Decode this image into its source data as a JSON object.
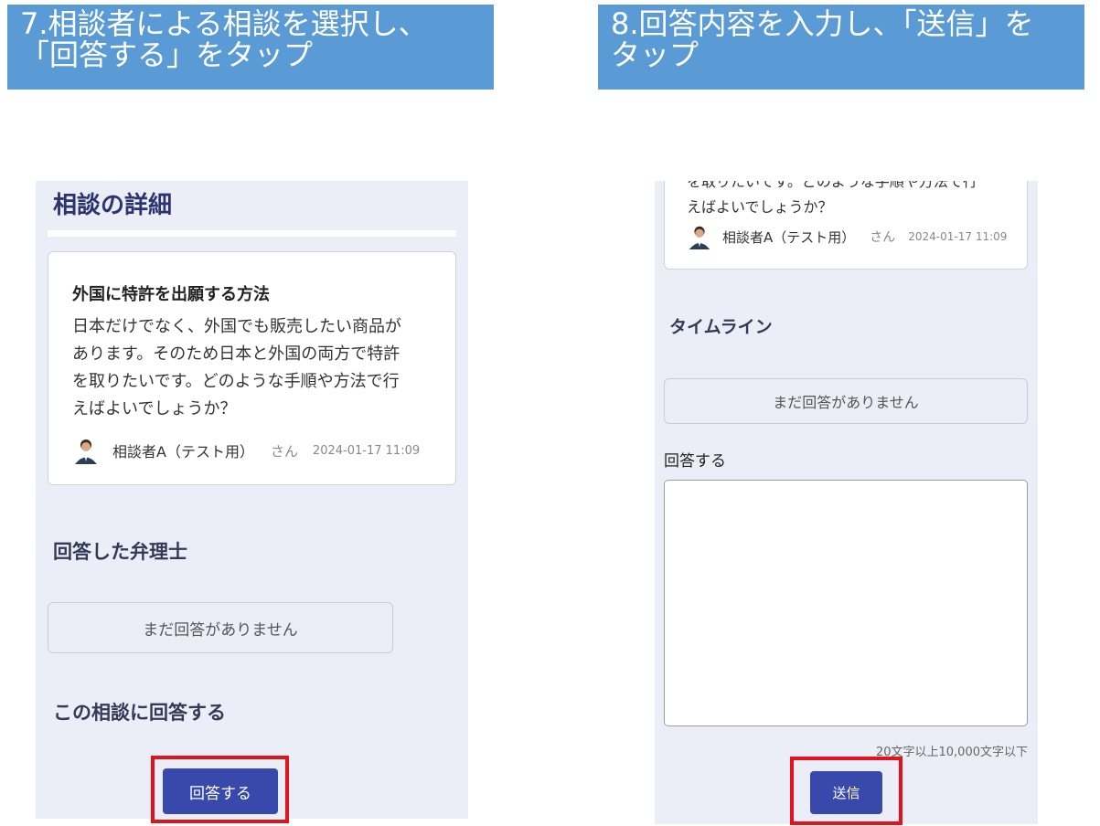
{
  "left": {
    "banner": {
      "line1": "7.相談者による相談を選択し、",
      "line2": "「回答する」をタップ"
    },
    "page_title": "相談の詳細",
    "card": {
      "title": "外国に特許を出願する方法",
      "body_lines": [
        "日本だけでなく、外国でも販売したい商品が",
        "あります。そのため日本と外国の両方で特許",
        "を取りたいです。どのような手順や方法で行",
        "えばよいでしょうか？"
      ],
      "author": "相談者A（テスト用）",
      "suffix": "さん",
      "date": "2024-01-17 11:09"
    },
    "answered_section_title": "回答した弁理士",
    "no_answer_text": "まだ回答がありません",
    "reply_section_title": "この相談に回答する",
    "reply_button": "回答する"
  },
  "right": {
    "banner": {
      "line1": "8.回答内容を入力し、「送信」を",
      "line2": "タップ"
    },
    "card": {
      "body_lines_partial": "を取りたいです。どのような手順や方法で行",
      "body_last_line": "えばよいでしょうか？",
      "author": "相談者A（テスト用）",
      "suffix": "さん",
      "date": "2024-01-17 11:09"
    },
    "timeline_title": "タイムライン",
    "no_answer_text": "まだ回答がありません",
    "answer_label": "回答する",
    "answer_value": "",
    "char_hint": "20文字以上10,000文字以下",
    "send_button": "送信"
  },
  "colors": {
    "banner_bg": "#5b9bd5",
    "phone_bg": "#eceef7",
    "primary_button": "#3949ab",
    "highlight_border": "#e4121b",
    "title_text": "#2c3470"
  }
}
